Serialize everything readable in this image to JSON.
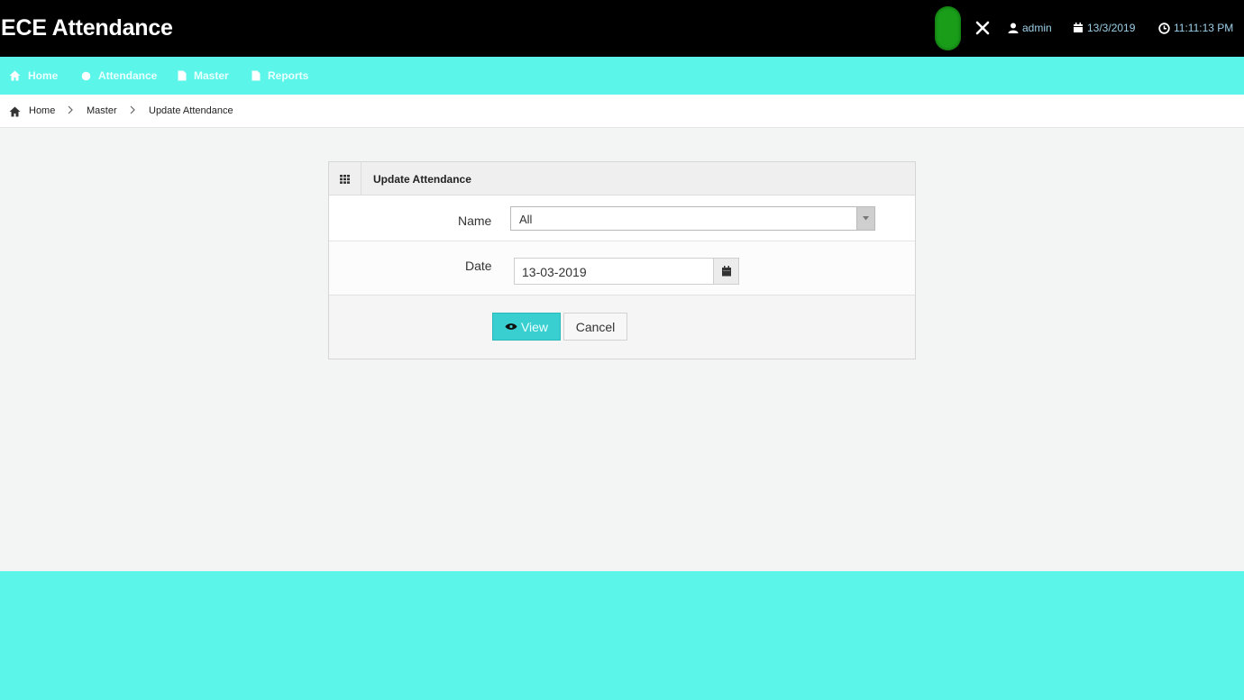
{
  "header": {
    "title": "ECE Attendance",
    "status_color": "#1a9e1a",
    "user": "admin",
    "date": "13/3/2019",
    "time": "11:11:13 PM"
  },
  "nav": {
    "items": [
      {
        "label": "Home",
        "icon": "home-icon"
      },
      {
        "label": "Attendance",
        "icon": "circle-icon"
      },
      {
        "label": "Master",
        "icon": "file-icon"
      },
      {
        "label": "Reports",
        "icon": "file-icon"
      }
    ]
  },
  "breadcrumb": {
    "items": [
      "Home",
      "Master",
      "Update Attendance"
    ]
  },
  "panel": {
    "title": "Update Attendance",
    "name_label": "Name",
    "name_value": "All",
    "date_label": "Date",
    "date_value": "13-03-2019",
    "view_label": "View",
    "cancel_label": "Cancel"
  },
  "colors": {
    "accent": "#5cf5ea",
    "button": "#39cfd1",
    "header_bg": "#000000"
  }
}
